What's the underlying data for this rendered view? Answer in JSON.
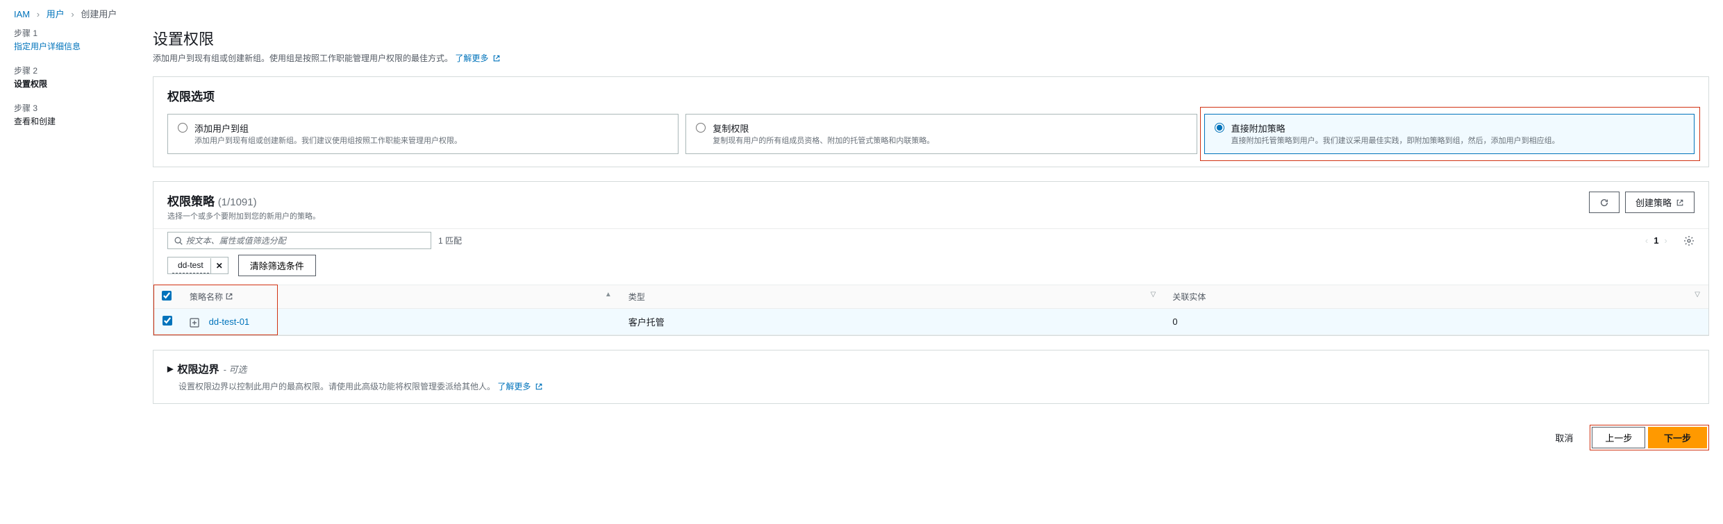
{
  "breadcrumb": {
    "root": "IAM",
    "users": "用户",
    "current": "创建用户"
  },
  "steps": [
    {
      "label": "步骤 1",
      "name": "指定用户详细信息"
    },
    {
      "label": "步骤 2",
      "name": "设置权限"
    },
    {
      "label": "步骤 3",
      "name": "查看和创建"
    }
  ],
  "page": {
    "title": "设置权限",
    "desc": "添加用户到现有组或创建新组。使用组是按照工作职能管理用户权限的最佳方式。",
    "learn_more": "了解更多"
  },
  "perm_options": {
    "header": "权限选项",
    "cards": [
      {
        "title": "添加用户到组",
        "desc": "添加用户到现有组或创建新组。我们建议使用组按照工作职能来管理用户权限。"
      },
      {
        "title": "复制权限",
        "desc": "复制现有用户的所有组成员资格、附加的托管式策略和内联策略。"
      },
      {
        "title": "直接附加策略",
        "desc": "直接附加托管策略到用户。我们建议采用最佳实践，即附加策略到组，然后，添加用户到相应组。"
      }
    ]
  },
  "policies": {
    "title": "权限策略",
    "count_label": "(1/1091)",
    "sub": "选择一个或多个要附加到您的新用户的策略。",
    "refresh": "",
    "create_policy": "创建策略",
    "search_placeholder": "按文本、属性或值筛选分配",
    "match_text": "1 匹配",
    "chip_label": "dd-test",
    "clear_filters": "清除筛选条件",
    "page_num": "1",
    "headers": {
      "name": "策略名称",
      "type": "类型",
      "attached": "关联实体"
    },
    "rows": [
      {
        "name": "dd-test-01",
        "type": "客户托管",
        "attached": "0"
      }
    ]
  },
  "boundary": {
    "title": "权限边界",
    "optional": "- 可选",
    "desc": "设置权限边界以控制此用户的最高权限。请使用此高级功能将权限管理委派给其他人。",
    "learn_more": "了解更多"
  },
  "footer": {
    "cancel": "取消",
    "prev": "上一步",
    "next": "下一步"
  }
}
